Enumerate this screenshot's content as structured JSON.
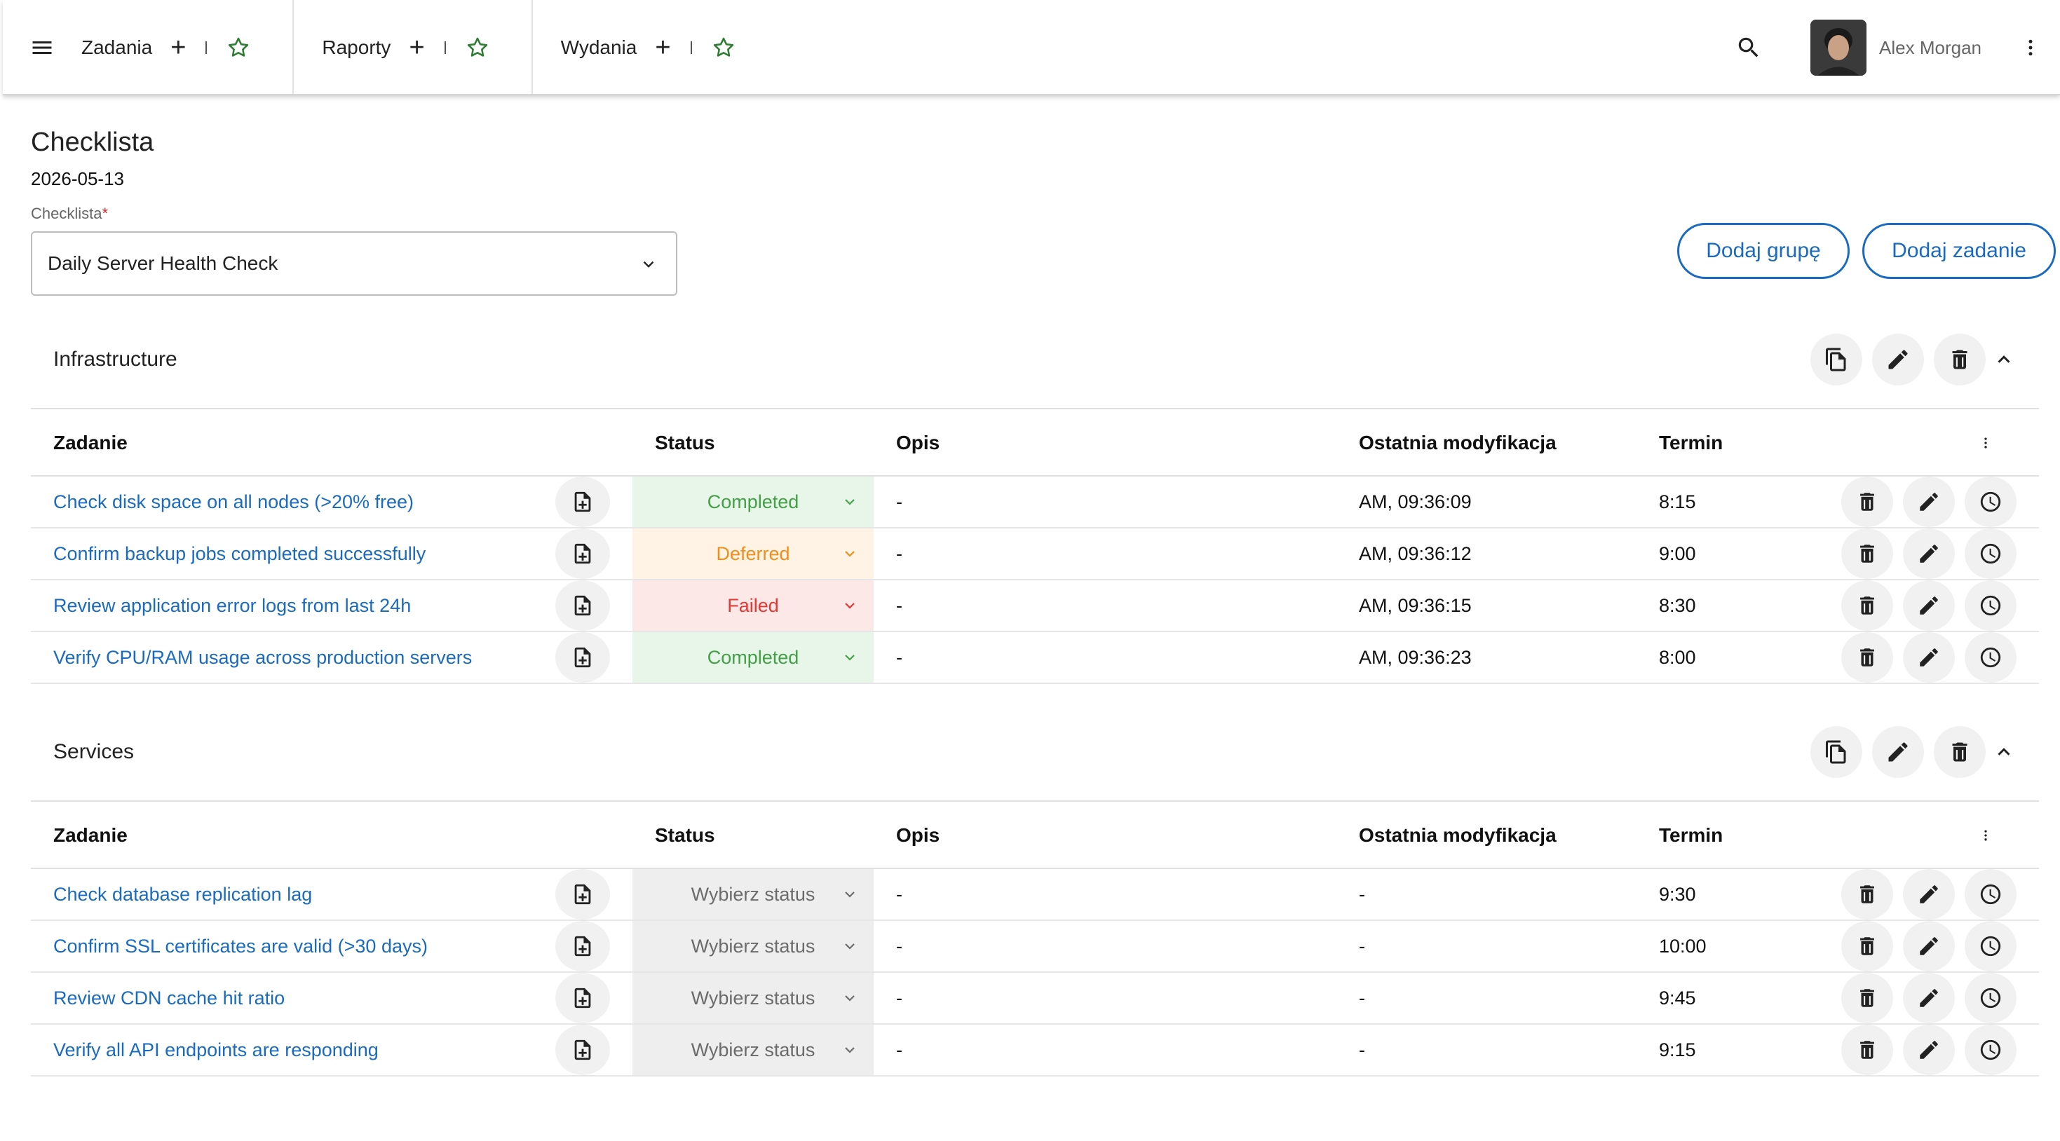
{
  "topbar": {
    "tabs": [
      {
        "label": "Zadania"
      },
      {
        "label": "Raporty"
      },
      {
        "label": "Wydania"
      }
    ],
    "user_name": "Alex Morgan"
  },
  "page": {
    "title": "Checklista",
    "date": "2026-05-13",
    "field_label": "Checklista",
    "field_required_mark": "*",
    "selected_checklist": "Daily Server Health Check",
    "add_group_label": "Dodaj grupę",
    "add_task_label": "Dodaj zadanie"
  },
  "columns": {
    "task": "Zadanie",
    "status": "Status",
    "description": "Opis",
    "modified": "Ostatnia modyfikacja",
    "deadline": "Termin"
  },
  "groups": [
    {
      "title": "Infrastructure",
      "rows": [
        {
          "task": "Check disk space on all nodes (>20% free)",
          "status": "Completed",
          "status_kind": "completed",
          "description": "-",
          "modified": "AM, 09:36:09",
          "deadline": "8:15"
        },
        {
          "task": "Confirm backup jobs completed successfully",
          "status": "Deferred",
          "status_kind": "deferred",
          "description": "-",
          "modified": "AM, 09:36:12",
          "deadline": "9:00"
        },
        {
          "task": "Review application error logs from last 24h",
          "status": "Failed",
          "status_kind": "failed",
          "description": "-",
          "modified": "AM, 09:36:15",
          "deadline": "8:30"
        },
        {
          "task": "Verify CPU/RAM usage across production servers",
          "status": "Completed",
          "status_kind": "completed",
          "description": "-",
          "modified": "AM, 09:36:23",
          "deadline": "8:00"
        }
      ]
    },
    {
      "title": "Services",
      "rows": [
        {
          "task": "Check database replication lag",
          "status": "Wybierz status",
          "status_kind": "none",
          "description": "-",
          "modified": "-",
          "deadline": "9:30"
        },
        {
          "task": "Confirm SSL certificates are valid (>30 days)",
          "status": "Wybierz status",
          "status_kind": "none",
          "description": "-",
          "modified": "-",
          "deadline": "10:00"
        },
        {
          "task": "Review CDN cache hit ratio",
          "status": "Wybierz status",
          "status_kind": "none",
          "description": "-",
          "modified": "-",
          "deadline": "9:45"
        },
        {
          "task": "Verify all API endpoints are responding",
          "status": "Wybierz status",
          "status_kind": "none",
          "description": "-",
          "modified": "-",
          "deadline": "9:15"
        }
      ]
    }
  ],
  "colors": {
    "accent": "#1a6bc0",
    "star": "#2e7d32",
    "completed": "#43a047",
    "deferred": "#ef8f1a",
    "failed": "#e53935"
  },
  "icons": {
    "menu": "menu-icon",
    "add": "plus-icon",
    "favorite": "star-outline-icon",
    "search": "search-icon",
    "more": "more-vert-icon",
    "copy": "copy-icon",
    "edit": "pencil-icon",
    "delete": "trash-icon",
    "collapse": "chevron-up-icon",
    "file_add": "file-plus-icon",
    "history": "clock-icon",
    "dropdown": "chevron-down-icon"
  }
}
